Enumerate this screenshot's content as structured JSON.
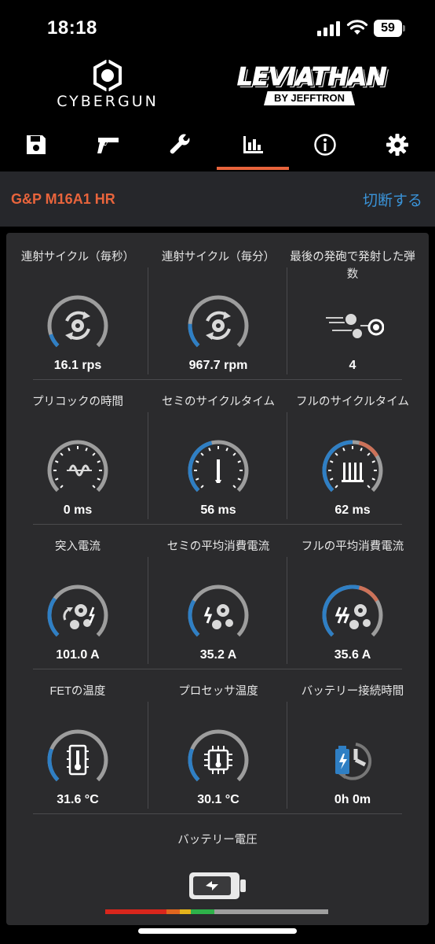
{
  "status_bar": {
    "time": "18:18",
    "battery_percent": "59"
  },
  "logos": {
    "left_brand": "CYBERGUN",
    "right_brand": "LEVIATHAN",
    "right_sub": "BY JEFFTRON"
  },
  "tabs": [
    {
      "icon": "save-icon",
      "active": false
    },
    {
      "icon": "gun-icon",
      "active": false
    },
    {
      "icon": "wrench-icon",
      "active": false
    },
    {
      "icon": "bar-chart-icon",
      "active": true
    },
    {
      "icon": "info-icon",
      "active": false
    },
    {
      "icon": "gear-icon",
      "active": false
    }
  ],
  "device": {
    "name": "G&P M16A1 HR",
    "disconnect_label": "切断する"
  },
  "stats": [
    {
      "label": "連射サイクル（毎秒）",
      "value": "16.1 rps",
      "icon": "cycle-gear-icon",
      "fill": 0.1,
      "accent": "#2f7fc4"
    },
    {
      "label": "連射サイクル（毎分）",
      "value": "967.7 rpm",
      "icon": "cycle-gear-icon",
      "fill": 0.18,
      "accent": "#2f7fc4"
    },
    {
      "label": "最後の発砲で発射した弾数",
      "value": "4",
      "icon": "bullets-icon",
      "fill": null,
      "accent": "#2f7fc4"
    },
    {
      "label": "プリコックの時間",
      "value": "0 ms",
      "icon": "spring-gauge-icon",
      "fill": 0.0,
      "accent": "#2f7fc4"
    },
    {
      "label": "セミのサイクルタイム",
      "value": "56 ms",
      "icon": "semi-gauge-icon",
      "fill": 0.45,
      "accent": "#2f7fc4"
    },
    {
      "label": "フルのサイクルタイム",
      "value": "62 ms",
      "icon": "full-gauge-icon",
      "fill": 0.5,
      "accent": "#2f7fc4"
    },
    {
      "label": "突入電流",
      "value": "101.0 A",
      "icon": "inrush-gear-icon",
      "fill": 0.3,
      "accent": "#2f7fc4"
    },
    {
      "label": "セミの平均消費電流",
      "value": "35.2 A",
      "icon": "semi-current-icon",
      "fill": 0.28,
      "accent": "#2f7fc4"
    },
    {
      "label": "フルの平均消費電流",
      "value": "35.6 A",
      "icon": "full-current-icon",
      "fill": 0.55,
      "accent": "#2f7fc4"
    },
    {
      "label": "FETの温度",
      "value": "31.6 °C",
      "icon": "thermometer-icon",
      "fill": 0.25,
      "accent": "#2f7fc4"
    },
    {
      "label": "プロセッサ温度",
      "value": "30.1 °C",
      "icon": "processor-icon",
      "fill": 0.25,
      "accent": "#2f7fc4"
    },
    {
      "label": "バッテリー接続時間",
      "value": "0h 0m",
      "icon": "battery-clock-icon",
      "fill": null,
      "accent": "#2f7fc4"
    }
  ],
  "battery_voltage": {
    "label": "バッテリー電圧",
    "icon": "battery-charge-icon",
    "level": 0.49,
    "colors": [
      "#d9261c",
      "#e0661f",
      "#e3b31c",
      "#2eb24a",
      "#9e9e9e"
    ]
  },
  "colors": {
    "accent": "#e8643c",
    "link": "#3a93d8",
    "gauge_blue": "#2f7fc4",
    "gauge_track": "#9d9d9d"
  }
}
